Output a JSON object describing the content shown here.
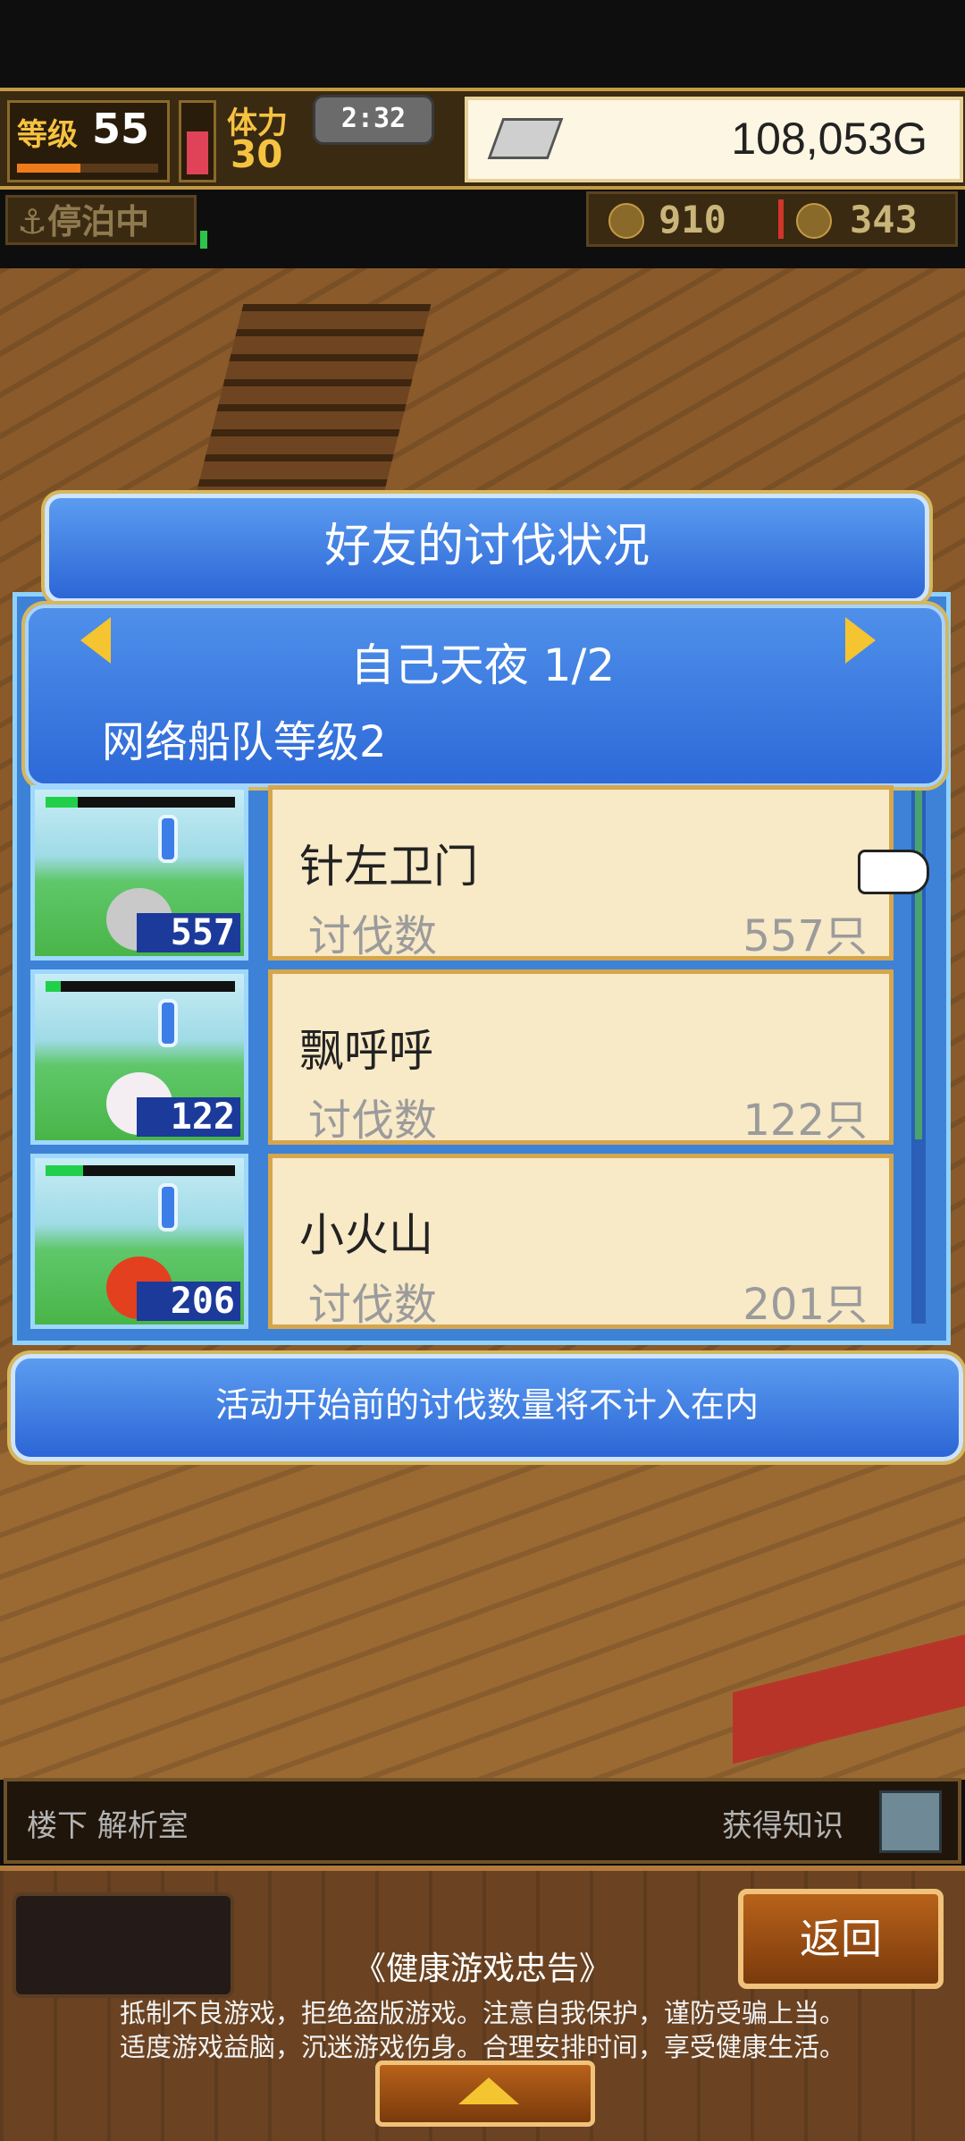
{
  "hud": {
    "level_label": "等级",
    "level": "55",
    "stamina_label": "体力",
    "stamina": "30",
    "time": "2:32",
    "gold": "108,053G",
    "status": "⚓停泊中",
    "resource1": "910",
    "resource2": "343"
  },
  "dialog": {
    "title": "好友的讨伐状况",
    "player": "自己天夜 1/2",
    "fleet": "网络船队等级2",
    "rows": [
      {
        "name": "针左卫门",
        "kills_label": "讨伐数",
        "kills": "557只",
        "thumb_count": "557",
        "hp": 0.17,
        "monster_color": "#c9c9c9"
      },
      {
        "name": "飘呼呼",
        "kills_label": "讨伐数",
        "kills": "122只",
        "thumb_count": "122",
        "hp": 0.08,
        "monster_color": "#f4eef2"
      },
      {
        "name": "小火山",
        "kills_label": "讨伐数",
        "kills": "201只",
        "thumb_count": "206",
        "hp": 0.2,
        "monster_color": "#e2401f"
      }
    ],
    "note": "活动开始前的讨伐数量将不计入在内"
  },
  "location": {
    "place": "楼下 解析室",
    "knowledge": "获得知识"
  },
  "footer": {
    "back": "返回",
    "advice_title": "《健康游戏忠告》",
    "advice_line1": "抵制不良游戏，拒绝盗版游戏。注意自我保护，谨防受骗上当。",
    "advice_line2": "适度游戏益脑，沉迷游戏伤身。合理安排时间，享受健康生活。"
  },
  "icons": {
    "anchor": "anchor-icon",
    "gold": "silver-ingot-icon",
    "search": "magnifier-icon"
  }
}
